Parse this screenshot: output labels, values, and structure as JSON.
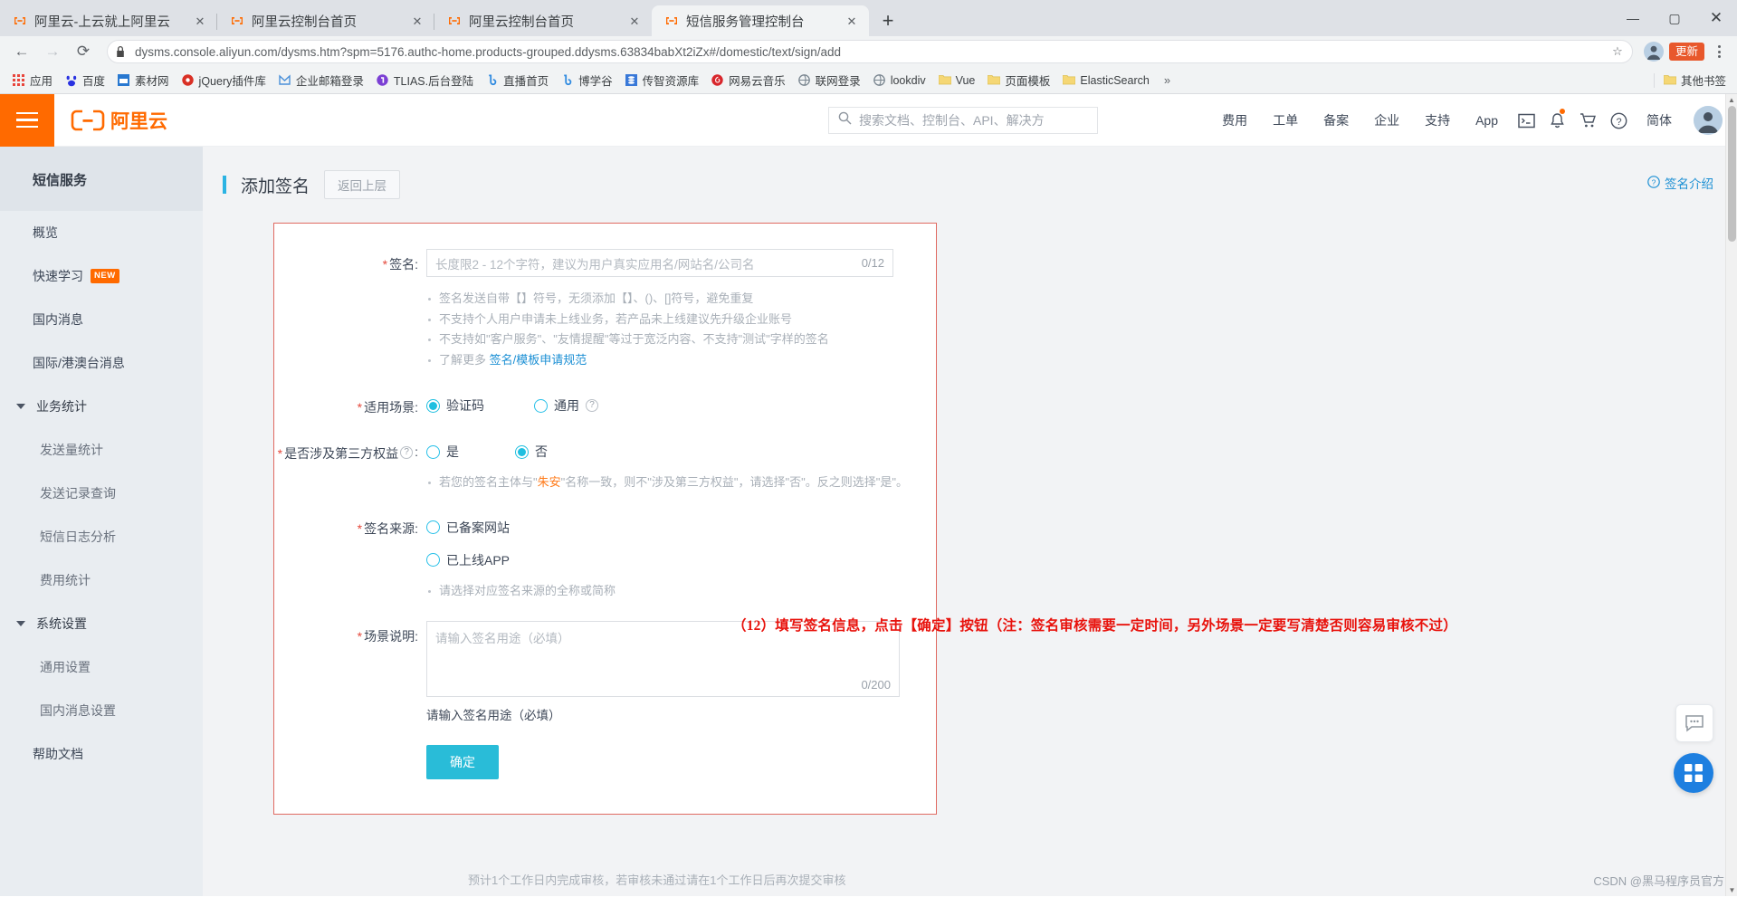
{
  "browser": {
    "tabs": [
      {
        "title": "阿里云-上云就上阿里云",
        "active": false
      },
      {
        "title": "阿里云控制台首页",
        "active": false
      },
      {
        "title": "阿里云控制台首页",
        "active": false
      },
      {
        "title": "短信服务管理控制台",
        "active": true
      }
    ],
    "new_tab_label": "+",
    "close_label": "✕",
    "window_controls": {
      "minimize": "—",
      "maximize": "▢",
      "close": "✕"
    },
    "nav": {
      "back": "←",
      "forward": "→",
      "reload": "⟳"
    },
    "omnibox": {
      "url": "dysms.console.aliyun.com/dysms.htm?spm=5176.authc-home.products-grouped.ddysms.63834babXt2iZx#/domestic/text/sign/add",
      "star": "☆",
      "lock_icon": "lock-icon"
    },
    "update_button": "更新",
    "bookmarks": [
      {
        "label": "应用",
        "icon": "apps-grid-icon",
        "color": "#e8453c"
      },
      {
        "label": "百度",
        "icon": "baidu-icon",
        "color": "#2932e1"
      },
      {
        "label": "素材网",
        "icon": "page-icon",
        "color": "#2878d0"
      },
      {
        "label": "jQuery插件库",
        "icon": "jquery-icon",
        "color": "#d93025"
      },
      {
        "label": "企业邮箱登录",
        "icon": "mail-icon",
        "color": "#4a90d9"
      },
      {
        "label": "TLIAS.后台登陆",
        "icon": "tlias-icon",
        "color": "#7b3fd4"
      },
      {
        "label": "直播首页",
        "icon": "bell-blue-icon",
        "color": "#2f8ae0"
      },
      {
        "label": "博学谷",
        "icon": "bell-blue-icon",
        "color": "#2f8ae0"
      },
      {
        "label": "传智资源库",
        "icon": "database-icon",
        "color": "#3878d8"
      },
      {
        "label": "网易云音乐",
        "icon": "netease-music-icon",
        "color": "#d8262c"
      },
      {
        "label": "联网登录",
        "icon": "globe-icon",
        "color": "#79858f"
      },
      {
        "label": "lookdiv",
        "icon": "globe-icon",
        "color": "#79858f"
      },
      {
        "label": "Vue",
        "icon": "folder-icon",
        "color": "#f5d775"
      },
      {
        "label": "页面模板",
        "icon": "folder-icon",
        "color": "#f5d775"
      },
      {
        "label": "ElasticSearch",
        "icon": "folder-icon",
        "color": "#f5d775"
      }
    ],
    "bookmarks_overflow": "»",
    "other_bookmarks": {
      "label": "其他书签",
      "icon": "folder-icon"
    }
  },
  "header": {
    "menu_icon": "hamburger-icon",
    "logo_text": "阿里云",
    "search_placeholder": "搜索文档、控制台、API、解决方",
    "search_icon": "search-icon",
    "links": [
      "费用",
      "工单",
      "备案",
      "企业",
      "支持",
      "App"
    ],
    "icons": [
      {
        "name": "terminal-icon",
        "glyph": "▣"
      },
      {
        "name": "bell-icon",
        "glyph": "🔔",
        "has_dot": true
      },
      {
        "name": "cart-icon",
        "glyph": "🛒"
      },
      {
        "name": "help-icon",
        "glyph": "?"
      }
    ],
    "lang": "简体",
    "avatar": "user-avatar"
  },
  "sidebar": {
    "title": "短信服务",
    "items": [
      {
        "label": "概览",
        "level": "top"
      },
      {
        "label": "快速学习",
        "level": "top",
        "badge": "NEW"
      },
      {
        "label": "国内消息",
        "level": "top"
      },
      {
        "label": "国际/港澳台消息",
        "level": "top"
      },
      {
        "label": "业务统计",
        "level": "group",
        "expanded": true
      },
      {
        "label": "发送量统计",
        "level": "sub"
      },
      {
        "label": "发送记录查询",
        "level": "sub"
      },
      {
        "label": "短信日志分析",
        "level": "sub"
      },
      {
        "label": "费用统计",
        "level": "sub"
      },
      {
        "label": "系统设置",
        "level": "group",
        "expanded": true
      },
      {
        "label": "通用设置",
        "level": "sub"
      },
      {
        "label": "国内消息设置",
        "level": "sub"
      },
      {
        "label": "帮助文档",
        "level": "top"
      }
    ]
  },
  "main": {
    "page_title": "添加签名",
    "back_button": "返回上层",
    "sign_intro_link": "签名介绍",
    "sign_intro_icon": "help-circle-icon",
    "annotation": "（12）填写签名信息，点击【确定】按钮（注：签名审核需要一定时间，另外场景一定要写清楚否则容易审核不过）",
    "bottom_hint": "预计1个工作日内完成审核，若审核未通过请在1个工作日后再次提交审核",
    "form": {
      "signature": {
        "label": "签名:",
        "required": true,
        "placeholder": "长度限2 - 12个字符，建议为用户真实应用名/网站名/公司名",
        "value": "",
        "counter": "0/12",
        "tips": [
          {
            "text": "签名发送自带【】符号，无须添加【】、()、[]符号，避免重复"
          },
          {
            "text": "不支持个人用户申请未上线业务，若产品未上线建议先升级企业账号"
          },
          {
            "text": "不支持如\"客户服务\"、\"友情提醒\"等过于宽泛内容、不支持\"测试\"字样的签名"
          },
          {
            "text": "了解更多 ",
            "link": "签名/模板申请规范"
          }
        ]
      },
      "scene": {
        "label": "适用场景:",
        "required": true,
        "options": [
          {
            "label": "验证码",
            "checked": true
          },
          {
            "label": "通用",
            "checked": false,
            "help": "?"
          }
        ]
      },
      "third_party": {
        "label": "是否涉及第三方权益",
        "label_suffix": ":",
        "required": true,
        "help": "?",
        "options": [
          {
            "label": "是",
            "checked": false
          },
          {
            "label": "否",
            "checked": true
          }
        ],
        "tip_prefix": "若您的签名主体与\"",
        "tip_highlight": "朱安",
        "tip_suffix": "\"名称一致，则不\"涉及第三方权益\"，请选择\"否\"。反之则选择\"是\"。"
      },
      "source": {
        "label": "签名来源:",
        "required": true,
        "options": [
          {
            "label": "已备案网站",
            "checked": false
          },
          {
            "label": "已上线APP",
            "checked": false
          }
        ],
        "tip": "请选择对应签名来源的全称或简称"
      },
      "description": {
        "label": "场景说明:",
        "required": true,
        "placeholder": "请输入签名用途（必填）",
        "value": "",
        "counter": "0/200",
        "helper": "请输入签名用途（必填）"
      },
      "submit": "确定"
    },
    "float_chat_icon": "chat-bubble-icon",
    "float_apps_icon": "apps-grid-icon"
  },
  "watermark": "CSDN @黑马程序员官方",
  "colors": {
    "brand_orange": "#ff6a00",
    "accent_cyan": "#29bcd8",
    "link_blue": "#1b8fd4",
    "required_red": "#e4493c",
    "annotation_red": "#e8120c",
    "card_border_red": "#e06a62"
  }
}
